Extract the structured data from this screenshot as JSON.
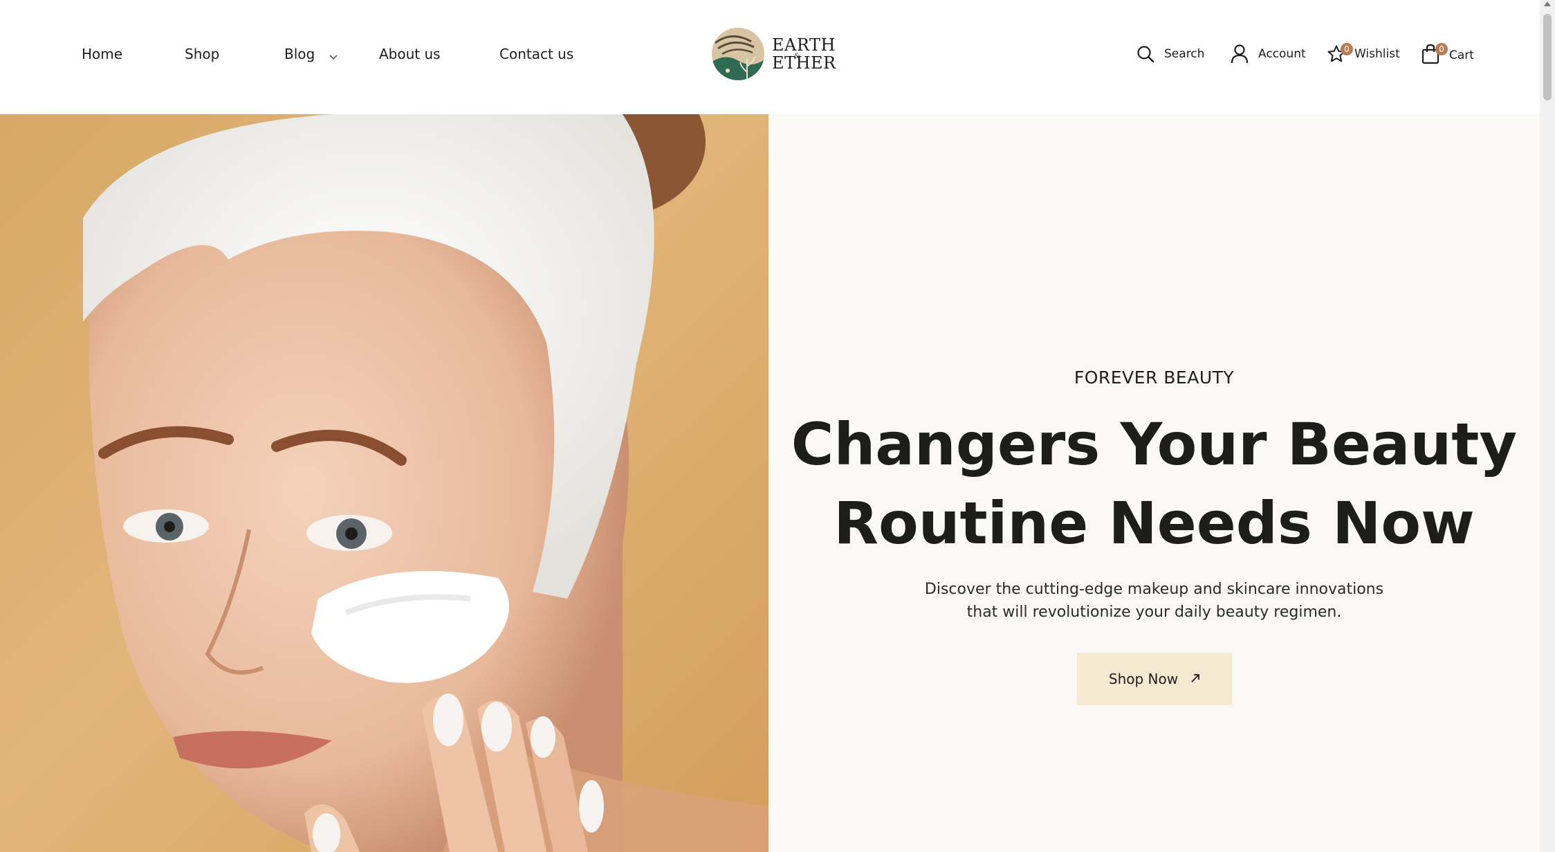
{
  "nav": {
    "items": [
      {
        "label": "Home"
      },
      {
        "label": "Shop"
      },
      {
        "label": "Blog"
      },
      {
        "label": "About us"
      },
      {
        "label": "Contact us"
      }
    ]
  },
  "logo": {
    "line1": "EARTH",
    "amp": "&",
    "line2": "ETHER"
  },
  "utilities": {
    "search_label": "Search",
    "account_label": "Account",
    "wishlist_label": "Wishlist",
    "wishlist_count": "0",
    "cart_label": "Cart",
    "cart_count": "0"
  },
  "hero": {
    "eyebrow": "FOREVER BEAUTY",
    "headline_line1": "Changers Your Beauty",
    "headline_line2": "Routine Needs Now",
    "description": "Discover the cutting-edge makeup and skincare innovations that will revolutionize your daily beauty regimen.",
    "cta_label": "Shop Now",
    "cta_icon": "arrow-up-right-icon"
  },
  "colors": {
    "accent_button": "#f6e9d2",
    "badge": "#b87c55",
    "hero_bg": "#fbf9f5",
    "text": "#1d1d1b"
  }
}
